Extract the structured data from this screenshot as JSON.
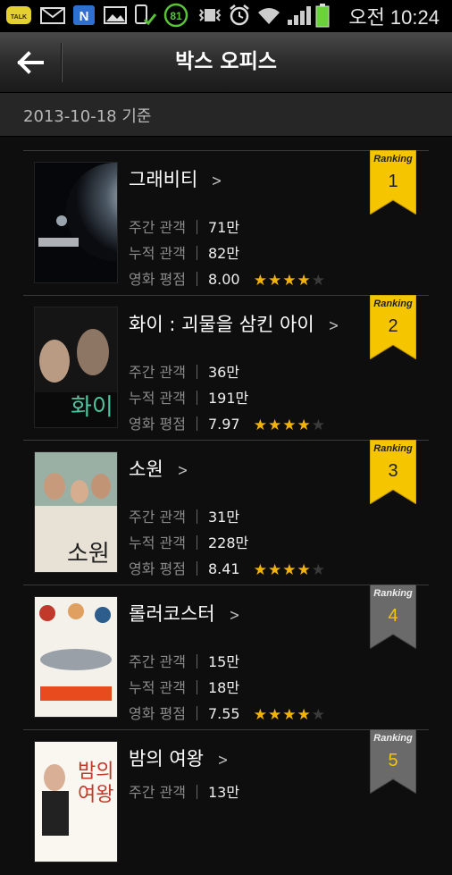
{
  "status_bar": {
    "icons": [
      "talk-icon",
      "mail-icon",
      "n-icon",
      "gallery-icon",
      "phone-check-icon",
      "battery-badge-icon",
      "vibrate-icon",
      "alarm-icon",
      "wifi-icon",
      "signal-icon",
      "battery-icon"
    ],
    "badge_value": "81",
    "time": "오전 10:24",
    "talk_text": "TALK",
    "n_text": "N"
  },
  "header": {
    "title": "박스 오피스"
  },
  "date_label": "2013-10-18 기준",
  "labels": {
    "weekly": "주간 관객",
    "total": "누적 관객",
    "rating": "영화 평점",
    "ranking": "Ranking",
    "arrow": ">"
  },
  "colors": {
    "gold_ribbon": "#f5c500",
    "gray_ribbon": "#6a6a6a",
    "star_on": "#f2b400",
    "star_off": "#3a3a3a"
  },
  "movies": [
    {
      "rank": "1",
      "title": "그래비티",
      "weekly": "71만",
      "total": "82만",
      "rating": "8.00",
      "stars": 4,
      "ribbon": "gold"
    },
    {
      "rank": "2",
      "title": "화이 : 괴물을 삼킨 아이",
      "weekly": "36만",
      "total": "191만",
      "rating": "7.97",
      "stars": 4,
      "ribbon": "gold"
    },
    {
      "rank": "3",
      "title": "소원",
      "weekly": "31만",
      "total": "228만",
      "rating": "8.41",
      "stars": 4,
      "ribbon": "gold"
    },
    {
      "rank": "4",
      "title": "롤러코스터",
      "weekly": "15만",
      "total": "18만",
      "rating": "7.55",
      "stars": 4,
      "ribbon": "gray"
    },
    {
      "rank": "5",
      "title": "밤의 여왕",
      "weekly": "13만",
      "total": "",
      "rating": "",
      "stars": 0,
      "ribbon": "gray"
    }
  ]
}
